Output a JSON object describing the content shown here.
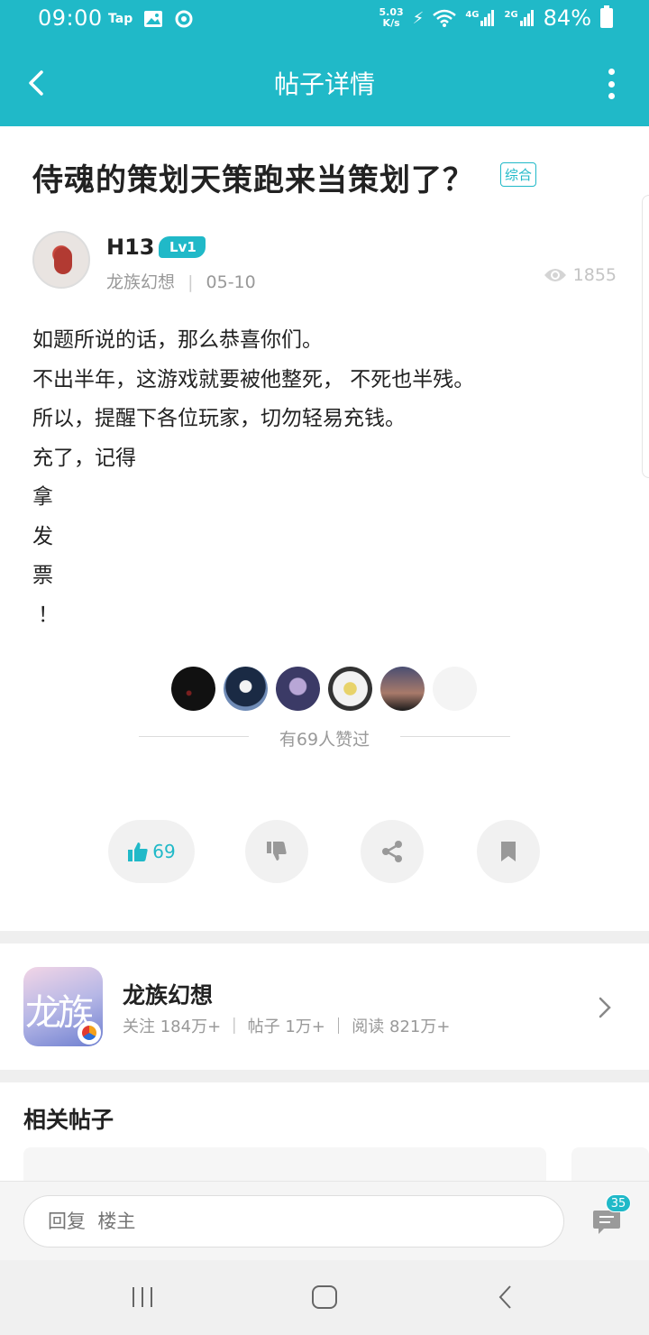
{
  "status_bar": {
    "time": "09:00",
    "left_icons": [
      "Tap",
      "image-icon",
      "sync-icon"
    ],
    "net_speed_value": "5.03",
    "net_speed_unit": "K/s",
    "signal_4g": "4G",
    "signal_2g": "2G",
    "battery": "84%"
  },
  "app_bar": {
    "title": "帖子详情"
  },
  "post": {
    "title": "侍魂的策划天策跑来当策划了？",
    "tag": "综合",
    "author": {
      "name": "H13",
      "level": "Lv1",
      "source": "龙族幻想",
      "separator": "|",
      "date": "05-10"
    },
    "views": "1855",
    "body_lines": [
      "如题所说的话，那么恭喜你们。",
      "不出半年，这游戏就要被他整死， 不死也半残。",
      "所以，提醒下各位玩家，切勿轻易充钱。",
      "充了，记得",
      "拿",
      "发",
      "票",
      "！"
    ],
    "likes_text": "有69人赞过",
    "like_count": "69"
  },
  "game_card": {
    "name": "龙族幻想",
    "icon_text": "龙族",
    "stats": "关注 184万+ ｜ 帖子 1万+ ｜ 阅读 821万+"
  },
  "related": {
    "title": "相关帖子"
  },
  "reply_bar": {
    "placeholder": "回复  楼主",
    "comment_count": "35"
  },
  "colors": {
    "accent": "#20b9c8",
    "text_primary": "#222222",
    "text_secondary": "#999999",
    "surface_gray": "#f1f1f1"
  }
}
